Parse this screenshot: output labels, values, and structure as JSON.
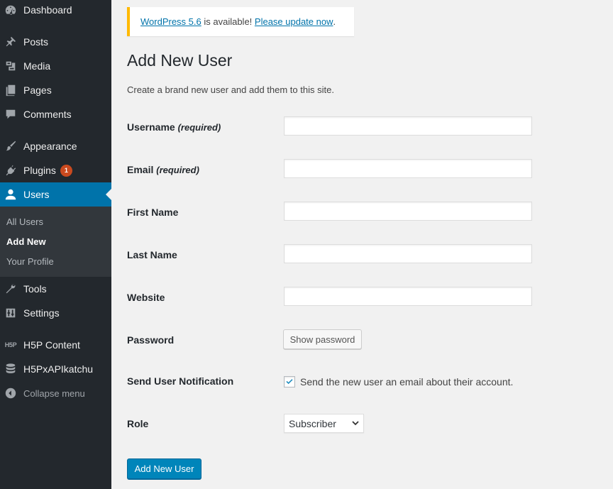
{
  "sidebar": {
    "items": [
      {
        "label": "Dashboard",
        "icon": "dashboard-icon"
      },
      {
        "label": "Posts",
        "icon": "pushpin-icon"
      },
      {
        "label": "Media",
        "icon": "media-icon"
      },
      {
        "label": "Pages",
        "icon": "pages-icon"
      },
      {
        "label": "Comments",
        "icon": "comment-icon"
      },
      {
        "label": "Appearance",
        "icon": "paintbrush-icon"
      },
      {
        "label": "Plugins",
        "icon": "plugin-icon",
        "badge": "1"
      },
      {
        "label": "Users",
        "icon": "user-icon",
        "active": true
      },
      {
        "label": "Tools",
        "icon": "wrench-icon"
      },
      {
        "label": "Settings",
        "icon": "settings-icon"
      },
      {
        "label": "H5P Content",
        "icon": "h5p-icon",
        "icon_text": "H5P"
      },
      {
        "label": "H5PxAPIkatchu",
        "icon": "database-icon"
      }
    ],
    "submenu": [
      {
        "label": "All Users"
      },
      {
        "label": "Add New",
        "current": true
      },
      {
        "label": "Your Profile"
      }
    ],
    "collapse_label": "Collapse menu"
  },
  "notice": {
    "link1": "WordPress 5.6",
    "middle": " is available! ",
    "link2": "Please update now",
    "end": "."
  },
  "page": {
    "title": "Add New User",
    "description": "Create a brand new user and add them to this site."
  },
  "form": {
    "username": {
      "label": "Username",
      "note": "(required)",
      "value": ""
    },
    "email": {
      "label": "Email",
      "note": "(required)",
      "value": ""
    },
    "first_name": {
      "label": "First Name",
      "value": ""
    },
    "last_name": {
      "label": "Last Name",
      "value": ""
    },
    "website": {
      "label": "Website",
      "value": ""
    },
    "password": {
      "label": "Password",
      "button": "Show password"
    },
    "notification": {
      "label": "Send User Notification",
      "checkbox_label": "Send the new user an email about their account.",
      "checked": true
    },
    "role": {
      "label": "Role",
      "selected": "Subscriber"
    },
    "submit": "Add New User"
  },
  "colors": {
    "sidebar_bg": "#23282d",
    "active_bg": "#0073aa",
    "notice_border": "#ffb900",
    "primary_button": "#0085ba",
    "badge": "#ca4a1f"
  }
}
